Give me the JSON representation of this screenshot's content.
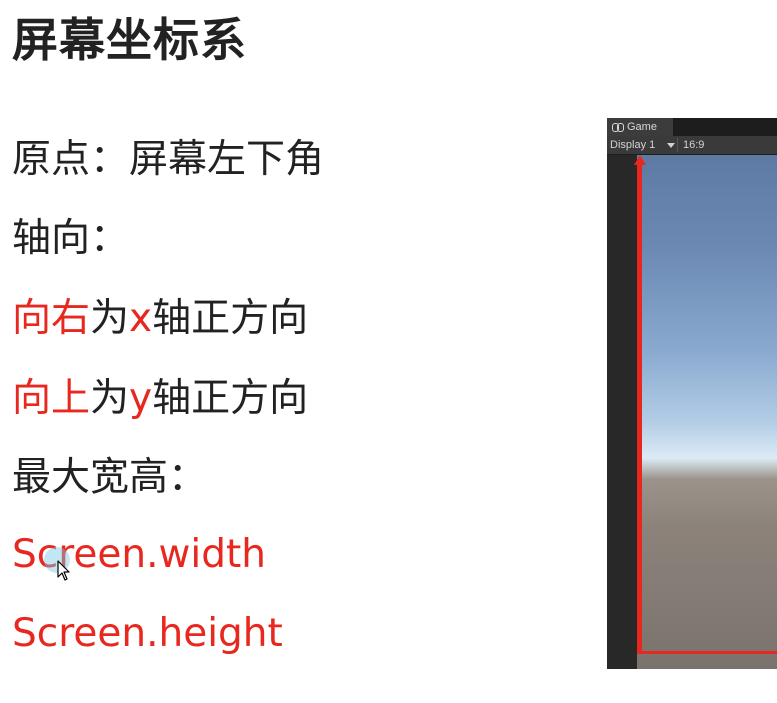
{
  "slide": {
    "title": "屏幕坐标系",
    "origin_label": "原点：屏幕左下角",
    "axis_label": "轴向：",
    "x_axis": {
      "red_text": "向右",
      "mid_text": "为",
      "axis_letter": "x",
      "suffix": "轴正方向"
    },
    "y_axis": {
      "red_text": "向上",
      "mid_text": "为",
      "axis_letter": "y",
      "suffix": "轴正方向"
    },
    "max_size_label": "最大宽高：",
    "screen_width": "Screen.width",
    "screen_height": "Screen.height"
  },
  "game_view": {
    "tab_label": "Game",
    "tab_icon": "gamepad-icon",
    "display_label": "Display 1",
    "aspect_label": "16:9"
  },
  "colors": {
    "accent_red": "#e8281f",
    "text_dark": "#222222",
    "editor_dark": "#282828"
  },
  "cursor": {
    "icon": "mouse-pointer-icon"
  }
}
